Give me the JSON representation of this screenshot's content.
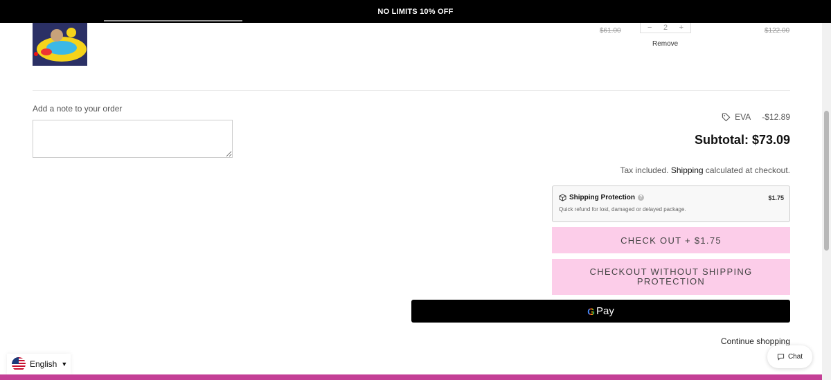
{
  "announcement": "NO LIMITS 10% OFF",
  "cart_item": {
    "price_original": "$61.00",
    "quantity": "2",
    "qty_minus": "−",
    "qty_plus": "+",
    "remove_label": "Remove",
    "line_total_original": "$122.00"
  },
  "note": {
    "label": "Add a note to your order",
    "value": ""
  },
  "discount": {
    "code": "EVA",
    "amount": "-$12.89"
  },
  "subtotal": "Subtotal: $73.09",
  "tax_note": {
    "prefix": "Tax included.",
    "link": "Shipping",
    "suffix": "calculated at checkout."
  },
  "shipping_protection": {
    "title": "Shipping Protection",
    "price": "$1.75",
    "description": "Quick refund for lost, damaged or delayed package.",
    "info": "?"
  },
  "buttons": {
    "checkout": "CHECK OUT + $1.75",
    "checkout_no_protection": "CHECKOUT WITHOUT SHIPPING PROTECTION",
    "gpay_g": "G",
    "gpay_label": "Pay"
  },
  "continue_shopping": "Continue shopping",
  "language": {
    "label": "English",
    "caret": "▼"
  },
  "chat": {
    "label": "Chat"
  },
  "colors": {
    "announcement_bg": "#000000",
    "checkout_button": "#fccde9",
    "bottom_bar": "#c43f96"
  }
}
